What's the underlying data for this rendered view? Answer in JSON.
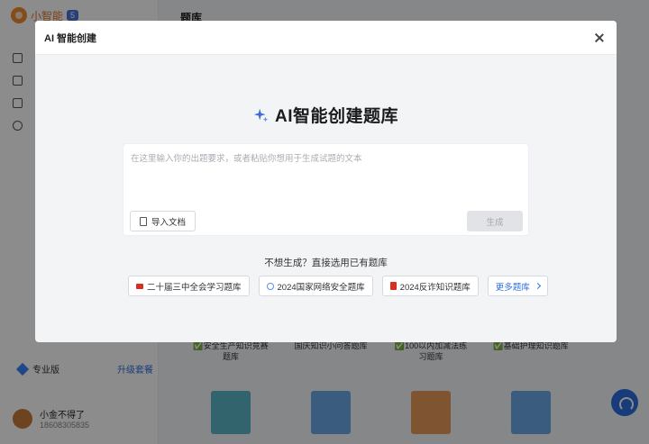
{
  "app": {
    "brand": {
      "name": "小智能",
      "badge": "5"
    },
    "page_title": "题库",
    "edition": {
      "label": "专业版",
      "upgrade": "升级套餐"
    },
    "user": {
      "name": "小金不得了",
      "phone": "18608305835"
    },
    "cards": [
      {
        "title": "✅安全生产知识竞赛题库",
        "color": "#5bb7c8"
      },
      {
        "title": "国庆知识小问答题库",
        "color": "#6aa8e8"
      },
      {
        "title": "✅100以内加减法练习题库",
        "color": "#e89b5a"
      },
      {
        "title": "✅基础护理知识题库",
        "color": "#6aa8e8"
      }
    ]
  },
  "modal": {
    "title": "AI 智能创建",
    "hero_title": "AI智能创建题库",
    "prompt_placeholder": "在这里输入你的出题要求，或者粘贴你想用于生成试题的文本",
    "import_label": "导入文档",
    "generate_label": "生成",
    "subtitle": "不想生成？直接选用已有题库",
    "chips": [
      {
        "label": "二十届三中全会学习题库",
        "icon": "flag-icon"
      },
      {
        "label": "2024国家网络安全题库",
        "icon": "globe-icon"
      },
      {
        "label": "2024反诈知识题库",
        "icon": "book-icon"
      }
    ],
    "more_label": "更多题库",
    "accent": "#2f6fe0"
  }
}
